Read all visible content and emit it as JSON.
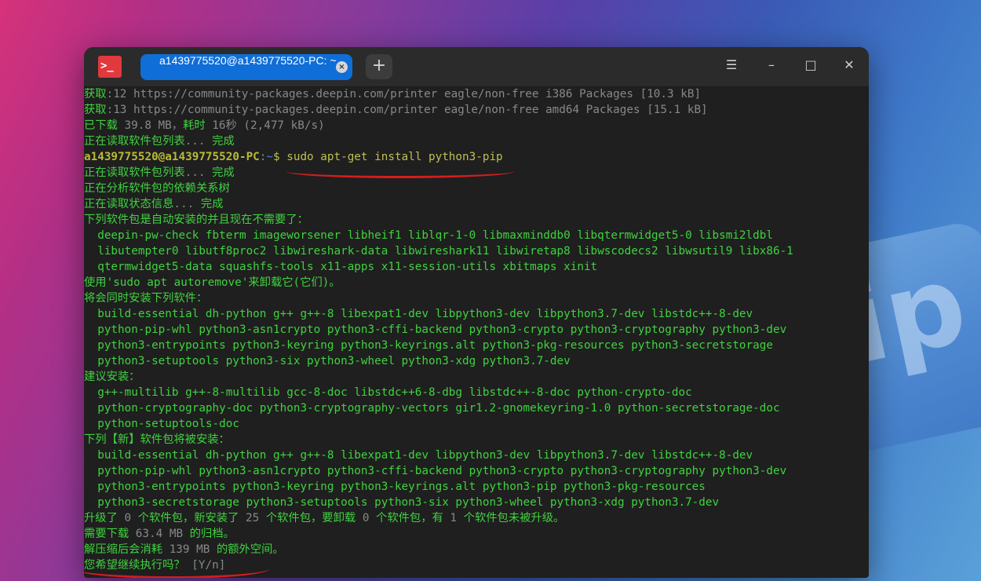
{
  "window": {
    "tab_title": "a1439775520@a1439775520-PC: ~",
    "app_icon_glyph": ">_",
    "new_tab_glyph": "+",
    "menu_glyph": "☰",
    "minimize_glyph": "–",
    "maximize_glyph": "□",
    "close_glyph": "✕",
    "tab_close_glyph": "×"
  },
  "terminal": {
    "lines": [
      [
        {
          "t": "获取",
          "c": ""
        },
        {
          "t": ":12 https://community-packages.deepin.com/printer eagle/non-free i386 Packages [10.3 kB]",
          "c": "dim"
        }
      ],
      [
        {
          "t": "获取",
          "c": ""
        },
        {
          "t": ":13 https://community-packages.deepin.com/printer eagle/non-free amd64 Packages [15.1 kB]",
          "c": "dim"
        }
      ],
      [
        {
          "t": "已下载 ",
          "c": ""
        },
        {
          "t": "39.8 MB，",
          "c": "dim"
        },
        {
          "t": "耗时 ",
          "c": ""
        },
        {
          "t": "16秒 (2,477 kB/s)",
          "c": "dim"
        }
      ],
      [
        {
          "t": "正在读取软件包列表",
          "c": ""
        },
        {
          "t": "... ",
          "c": "dim"
        },
        {
          "t": "完成",
          "c": ""
        }
      ],
      [
        {
          "t": "a1439775520@a1439775520-PC",
          "c": "prompt"
        },
        {
          "t": ":",
          "c": "dim"
        },
        {
          "t": "~",
          "c": "path"
        },
        {
          "t": "$ sudo apt-get install python3-pip",
          "c": "cmd"
        }
      ],
      [
        {
          "t": "正在读取软件包列表",
          "c": ""
        },
        {
          "t": "... ",
          "c": "dim"
        },
        {
          "t": "完成",
          "c": ""
        }
      ],
      [
        {
          "t": "正在分析软件包的依赖关系树",
          "c": ""
        }
      ],
      [
        {
          "t": "正在读取状态信息",
          "c": ""
        },
        {
          "t": "... ",
          "c": "dim"
        },
        {
          "t": "完成",
          "c": ""
        }
      ],
      [
        {
          "t": "下列软件包是自动安装的并且现在不需要了：",
          "c": ""
        }
      ],
      [
        {
          "t": "  deepin-pw-check fbterm imageworsener libheif1 liblqr-1-0 libmaxminddb0 libqtermwidget5-0 libsmi2ldbl",
          "c": ""
        }
      ],
      [
        {
          "t": "  libutempter0 libutf8proc2 libwireshark-data libwireshark11 libwiretap8 libwscodecs2 libwsutil9 libx86-1",
          "c": ""
        }
      ],
      [
        {
          "t": "  qtermwidget5-data squashfs-tools x11-apps x11-session-utils xbitmaps xinit",
          "c": ""
        }
      ],
      [
        {
          "t": "使用",
          "c": ""
        },
        {
          "t": "'sudo apt autoremove'",
          "c": ""
        },
        {
          "t": "来卸载它(它们)。",
          "c": ""
        }
      ],
      [
        {
          "t": "将会同时安装下列软件：",
          "c": ""
        }
      ],
      [
        {
          "t": "  build-essential dh-python g++ g++-8 libexpat1-dev libpython3-dev libpython3.7-dev libstdc++-8-dev",
          "c": ""
        }
      ],
      [
        {
          "t": "  python-pip-whl python3-asn1crypto python3-cffi-backend python3-crypto python3-cryptography python3-dev",
          "c": ""
        }
      ],
      [
        {
          "t": "  python3-entrypoints python3-keyring python3-keyrings.alt python3-pkg-resources python3-secretstorage",
          "c": ""
        }
      ],
      [
        {
          "t": "  python3-setuptools python3-six python3-wheel python3-xdg python3.7-dev",
          "c": ""
        }
      ],
      [
        {
          "t": "建议安装：",
          "c": ""
        }
      ],
      [
        {
          "t": "  g++-multilib g++-8-multilib gcc-8-doc libstdc++6-8-dbg libstdc++-8-doc python-crypto-doc",
          "c": ""
        }
      ],
      [
        {
          "t": "  python-cryptography-doc python3-cryptography-vectors gir1.2-gnomekeyring-1.0 python-secretstorage-doc",
          "c": ""
        }
      ],
      [
        {
          "t": "  python-setuptools-doc",
          "c": ""
        }
      ],
      [
        {
          "t": "下列【新】软件包将被安装：",
          "c": ""
        }
      ],
      [
        {
          "t": "  build-essential dh-python g++ g++-8 libexpat1-dev libpython3-dev libpython3.7-dev libstdc++-8-dev",
          "c": ""
        }
      ],
      [
        {
          "t": "  python-pip-whl python3-asn1crypto python3-cffi-backend python3-crypto python3-cryptography python3-dev",
          "c": ""
        }
      ],
      [
        {
          "t": "  python3-entrypoints python3-keyring python3-keyrings.alt python3-pip python3-pkg-resources",
          "c": ""
        }
      ],
      [
        {
          "t": "  python3-secretstorage python3-setuptools python3-six python3-wheel python3-xdg python3.7-dev",
          "c": ""
        }
      ],
      [
        {
          "t": "升级了 ",
          "c": ""
        },
        {
          "t": "0 ",
          "c": "dim"
        },
        {
          "t": "个软件包，新安装了 ",
          "c": ""
        },
        {
          "t": "25 ",
          "c": "dim"
        },
        {
          "t": "个软件包，要卸载 ",
          "c": ""
        },
        {
          "t": "0 ",
          "c": "dim"
        },
        {
          "t": "个软件包，有 ",
          "c": ""
        },
        {
          "t": "1 ",
          "c": "dim"
        },
        {
          "t": "个软件包未被升级。",
          "c": ""
        }
      ],
      [
        {
          "t": "需要下载 ",
          "c": ""
        },
        {
          "t": "63.4 MB ",
          "c": "dim"
        },
        {
          "t": "的归档。",
          "c": ""
        }
      ],
      [
        {
          "t": "解压缩后会消耗 ",
          "c": ""
        },
        {
          "t": "139 MB ",
          "c": "dim"
        },
        {
          "t": "的额外空间。",
          "c": ""
        }
      ],
      [
        {
          "t": "您希望继续执行吗？ ",
          "c": ""
        },
        {
          "t": "[Y/n]",
          "c": "dim"
        }
      ]
    ]
  }
}
